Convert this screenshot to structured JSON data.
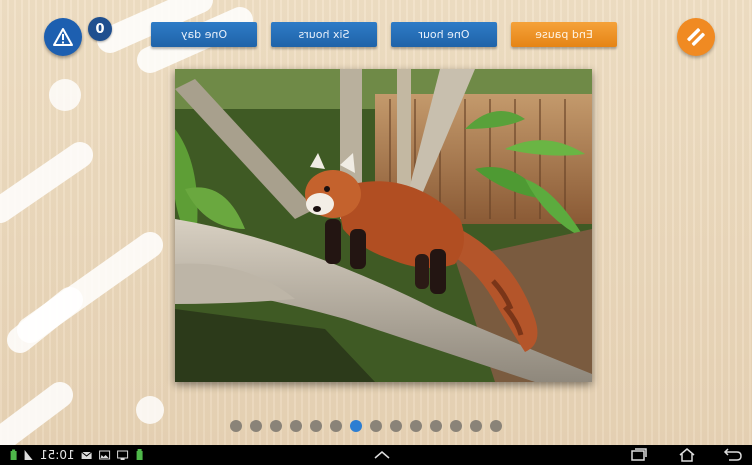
{
  "header": {
    "alert_count": "0",
    "tabs": [
      {
        "label": "One day"
      },
      {
        "label": "Six hours"
      },
      {
        "label": "One hour"
      },
      {
        "label": "End pause"
      }
    ]
  },
  "carousel": {
    "total_pages": 14,
    "current_page": 7
  },
  "statusbar": {
    "time": "10:51"
  },
  "colors": {
    "tab_blue": "#1f63a8",
    "tab_orange": "#e58415",
    "active_dot": "#2d7ed2",
    "brand": "#f08a22"
  }
}
